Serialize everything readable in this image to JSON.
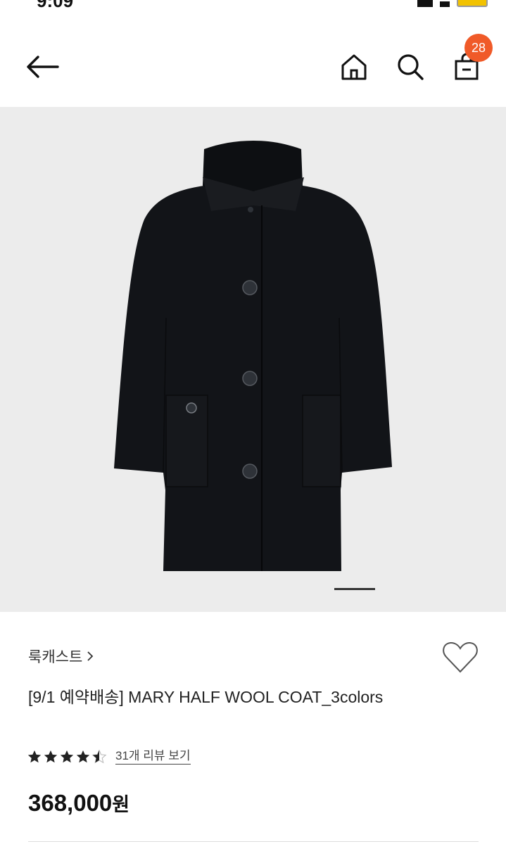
{
  "status": {
    "time": "9:09"
  },
  "header": {
    "cart_count": "28"
  },
  "product": {
    "brand": "룩캐스트",
    "title": "[9/1 예약배송] MARY HALF WOOL COAT_3colors",
    "rating": 4.5,
    "review_link": "31개 리뷰 보기",
    "price": "368,000",
    "price_unit": "원"
  },
  "colors": {
    "badge": "#f05a28",
    "image_bg": "#ececec",
    "coat": "#121418"
  },
  "icons": {
    "back": "arrow-left-icon",
    "home": "home-icon",
    "search": "search-icon",
    "bag": "shopping-bag-icon",
    "wish": "heart-icon"
  }
}
